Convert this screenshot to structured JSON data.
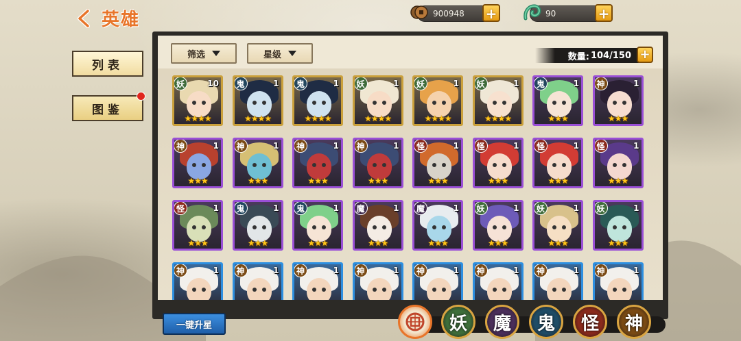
{
  "header": {
    "title": "英雄",
    "coins": "900948",
    "gems": "90"
  },
  "sidebar": {
    "list_label": "列表",
    "codex_label": "图鉴"
  },
  "toolbar": {
    "filter_label": "筛选",
    "star_label": "星级",
    "count_label": "数量:",
    "count_value": "104/150"
  },
  "heroes": [
    {
      "type": "妖",
      "level": "10",
      "stars": "★★★★",
      "frame": "gold",
      "hair": "#e9d9b0",
      "skin": "#f7dcc6"
    },
    {
      "type": "鬼",
      "level": "1",
      "stars": "★★★★",
      "frame": "gold",
      "hair": "#1f2c44",
      "skin": "#cfe2ef"
    },
    {
      "type": "鬼",
      "level": "1",
      "stars": "★★★★",
      "frame": "gold",
      "hair": "#1f2c44",
      "skin": "#cfe2ef"
    },
    {
      "type": "妖",
      "level": "1",
      "stars": "★★★★",
      "frame": "gold",
      "hair": "#f0e7d2",
      "skin": "#f7dcc6"
    },
    {
      "type": "妖",
      "level": "1",
      "stars": "★★★★",
      "frame": "gold",
      "hair": "#e7a24a",
      "skin": "#f5d2ad"
    },
    {
      "type": "妖",
      "level": "1",
      "stars": "★★★★",
      "frame": "gold",
      "hair": "#efe7d6",
      "skin": "#f7e1cf"
    },
    {
      "type": "鬼",
      "level": "1",
      "stars": "★★★",
      "frame": "purple",
      "hair": "#7fd08a",
      "skin": "#f6e4d5"
    },
    {
      "type": "神",
      "level": "1",
      "stars": "★★★",
      "frame": "purple",
      "hair": "#2a2033",
      "skin": "#f6ddd0"
    },
    {
      "type": "神",
      "level": "1",
      "stars": "★★★",
      "frame": "purple",
      "hair": "#b8412e",
      "skin": "#8aa7e2"
    },
    {
      "type": "神",
      "level": "1",
      "stars": "★★★",
      "frame": "purple",
      "hair": "#d6bf74",
      "skin": "#6fbfd3"
    },
    {
      "type": "神",
      "level": "1",
      "stars": "★★★",
      "frame": "purple",
      "hair": "#3c4c74",
      "skin": "#c03b3b"
    },
    {
      "type": "神",
      "level": "1",
      "stars": "★★★",
      "frame": "purple",
      "hair": "#3c4c74",
      "skin": "#c03b3b"
    },
    {
      "type": "怪",
      "level": "1",
      "stars": "★★★",
      "frame": "purple",
      "hair": "#d16a2c",
      "skin": "#d8d3c9"
    },
    {
      "type": "怪",
      "level": "1",
      "stars": "★★★",
      "frame": "purple",
      "hair": "#d23c34",
      "skin": "#f6dccc"
    },
    {
      "type": "怪",
      "level": "1",
      "stars": "★★★",
      "frame": "purple",
      "hair": "#d23c34",
      "skin": "#f6dccc"
    },
    {
      "type": "怪",
      "level": "1",
      "stars": "★★★",
      "frame": "purple",
      "hair": "#5a3a8a",
      "skin": "#f4d8cf"
    },
    {
      "type": "怪",
      "level": "1",
      "stars": "★★★",
      "frame": "purple",
      "hair": "#6b8a5a",
      "skin": "#d9e0b8"
    },
    {
      "type": "鬼",
      "level": "1",
      "stars": "★★★",
      "frame": "purple",
      "hair": "#3a4a56",
      "skin": "#e2e6e8"
    },
    {
      "type": "鬼",
      "level": "1",
      "stars": "★★★",
      "frame": "purple",
      "hair": "#7fd08a",
      "skin": "#f6e4d5"
    },
    {
      "type": "魔",
      "level": "1",
      "stars": "★★★",
      "frame": "purple",
      "hair": "#6a3f2a",
      "skin": "#f4ece4"
    },
    {
      "type": "魔",
      "level": "1",
      "stars": "★★★",
      "frame": "purple",
      "hair": "#e8ecef",
      "skin": "#a9d7ea"
    },
    {
      "type": "妖",
      "level": "1",
      "stars": "★★★",
      "frame": "purple",
      "hair": "#6d5bb8",
      "skin": "#f6e2d6"
    },
    {
      "type": "妖",
      "level": "1",
      "stars": "★★★",
      "frame": "purple",
      "hair": "#d8c18b",
      "skin": "#f6dfc4"
    },
    {
      "type": "妖",
      "level": "1",
      "stars": "★★★",
      "frame": "purple",
      "hair": "#2a5a56",
      "skin": "#bfe5dc"
    },
    {
      "type": "神",
      "level": "1",
      "stars": "",
      "frame": "blue",
      "hair": "#f2f0ec",
      "skin": "#f3d6bd"
    },
    {
      "type": "神",
      "level": "1",
      "stars": "",
      "frame": "blue",
      "hair": "#f2f0ec",
      "skin": "#f3d6bd"
    },
    {
      "type": "神",
      "level": "1",
      "stars": "",
      "frame": "blue",
      "hair": "#f2f0ec",
      "skin": "#f3d6bd"
    },
    {
      "type": "神",
      "level": "1",
      "stars": "",
      "frame": "blue",
      "hair": "#f2f0ec",
      "skin": "#f3d6bd"
    },
    {
      "type": "神",
      "level": "1",
      "stars": "",
      "frame": "blue",
      "hair": "#f2f0ec",
      "skin": "#f3d6bd"
    },
    {
      "type": "神",
      "level": "1",
      "stars": "",
      "frame": "blue",
      "hair": "#f2f0ec",
      "skin": "#f3d6bd"
    },
    {
      "type": "神",
      "level": "1",
      "stars": "",
      "frame": "blue",
      "hair": "#f2f0ec",
      "skin": "#f3d6bd"
    },
    {
      "type": "神",
      "level": "1",
      "stars": "",
      "frame": "blue",
      "hair": "#f2f0ec",
      "skin": "#f3d6bd"
    }
  ],
  "bottom": {
    "upstar_label": "一键升星",
    "filters": [
      {
        "label": "",
        "icon": "all-filter-icon",
        "color": "#c0452a"
      },
      {
        "label": "妖",
        "color": "#3e6e3a"
      },
      {
        "label": "魔",
        "color": "#4a2e5a"
      },
      {
        "label": "鬼",
        "color": "#1f4c66"
      },
      {
        "label": "怪",
        "color": "#8a2a1c"
      },
      {
        "label": "神",
        "color": "#7a4a14"
      }
    ]
  }
}
